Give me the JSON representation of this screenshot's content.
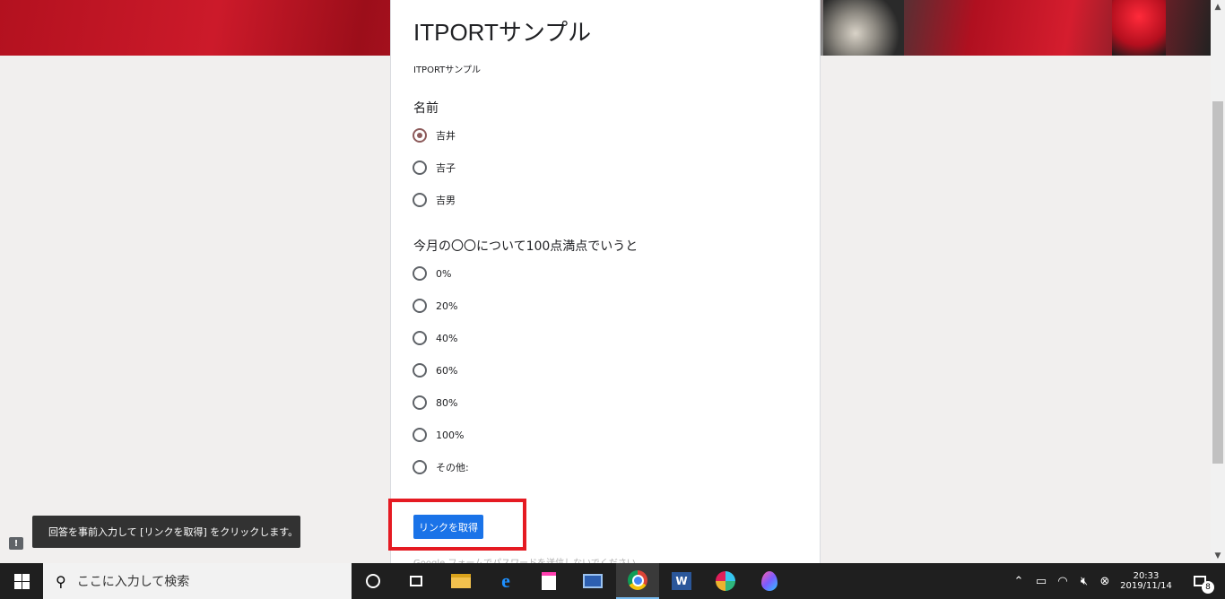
{
  "form": {
    "title": "ITPORTサンプル",
    "description": "ITPORTサンプル",
    "q1": {
      "title": "名前",
      "options": [
        "吉井",
        "吉子",
        "吉男"
      ],
      "selected": "吉井"
    },
    "q2": {
      "title": "今月の〇〇について100点満点でいうと",
      "options": [
        "0%",
        "20%",
        "40%",
        "60%",
        "80%",
        "100%",
        "その他:"
      ]
    },
    "get_link_label": "リンクを取得",
    "footer_note": "Google フォームでパスワードを送信しないでください。"
  },
  "toast": {
    "message": "回答を事前入力して [リンクを取得] をクリックします。"
  },
  "feedback_icon": "!",
  "highlight_color": "#e51a22",
  "accent_color": "#1a73e8",
  "taskbar": {
    "search_placeholder": "ここに入力して検索",
    "apps": [
      "cortana",
      "task-view",
      "file-explorer",
      "internet-explorer",
      "notepad",
      "remote-desktop",
      "chrome",
      "word",
      "slack",
      "maps"
    ],
    "active_app": "chrome",
    "clock_time": "20:33",
    "clock_date": "2019/11/14",
    "notification_count": "8"
  }
}
